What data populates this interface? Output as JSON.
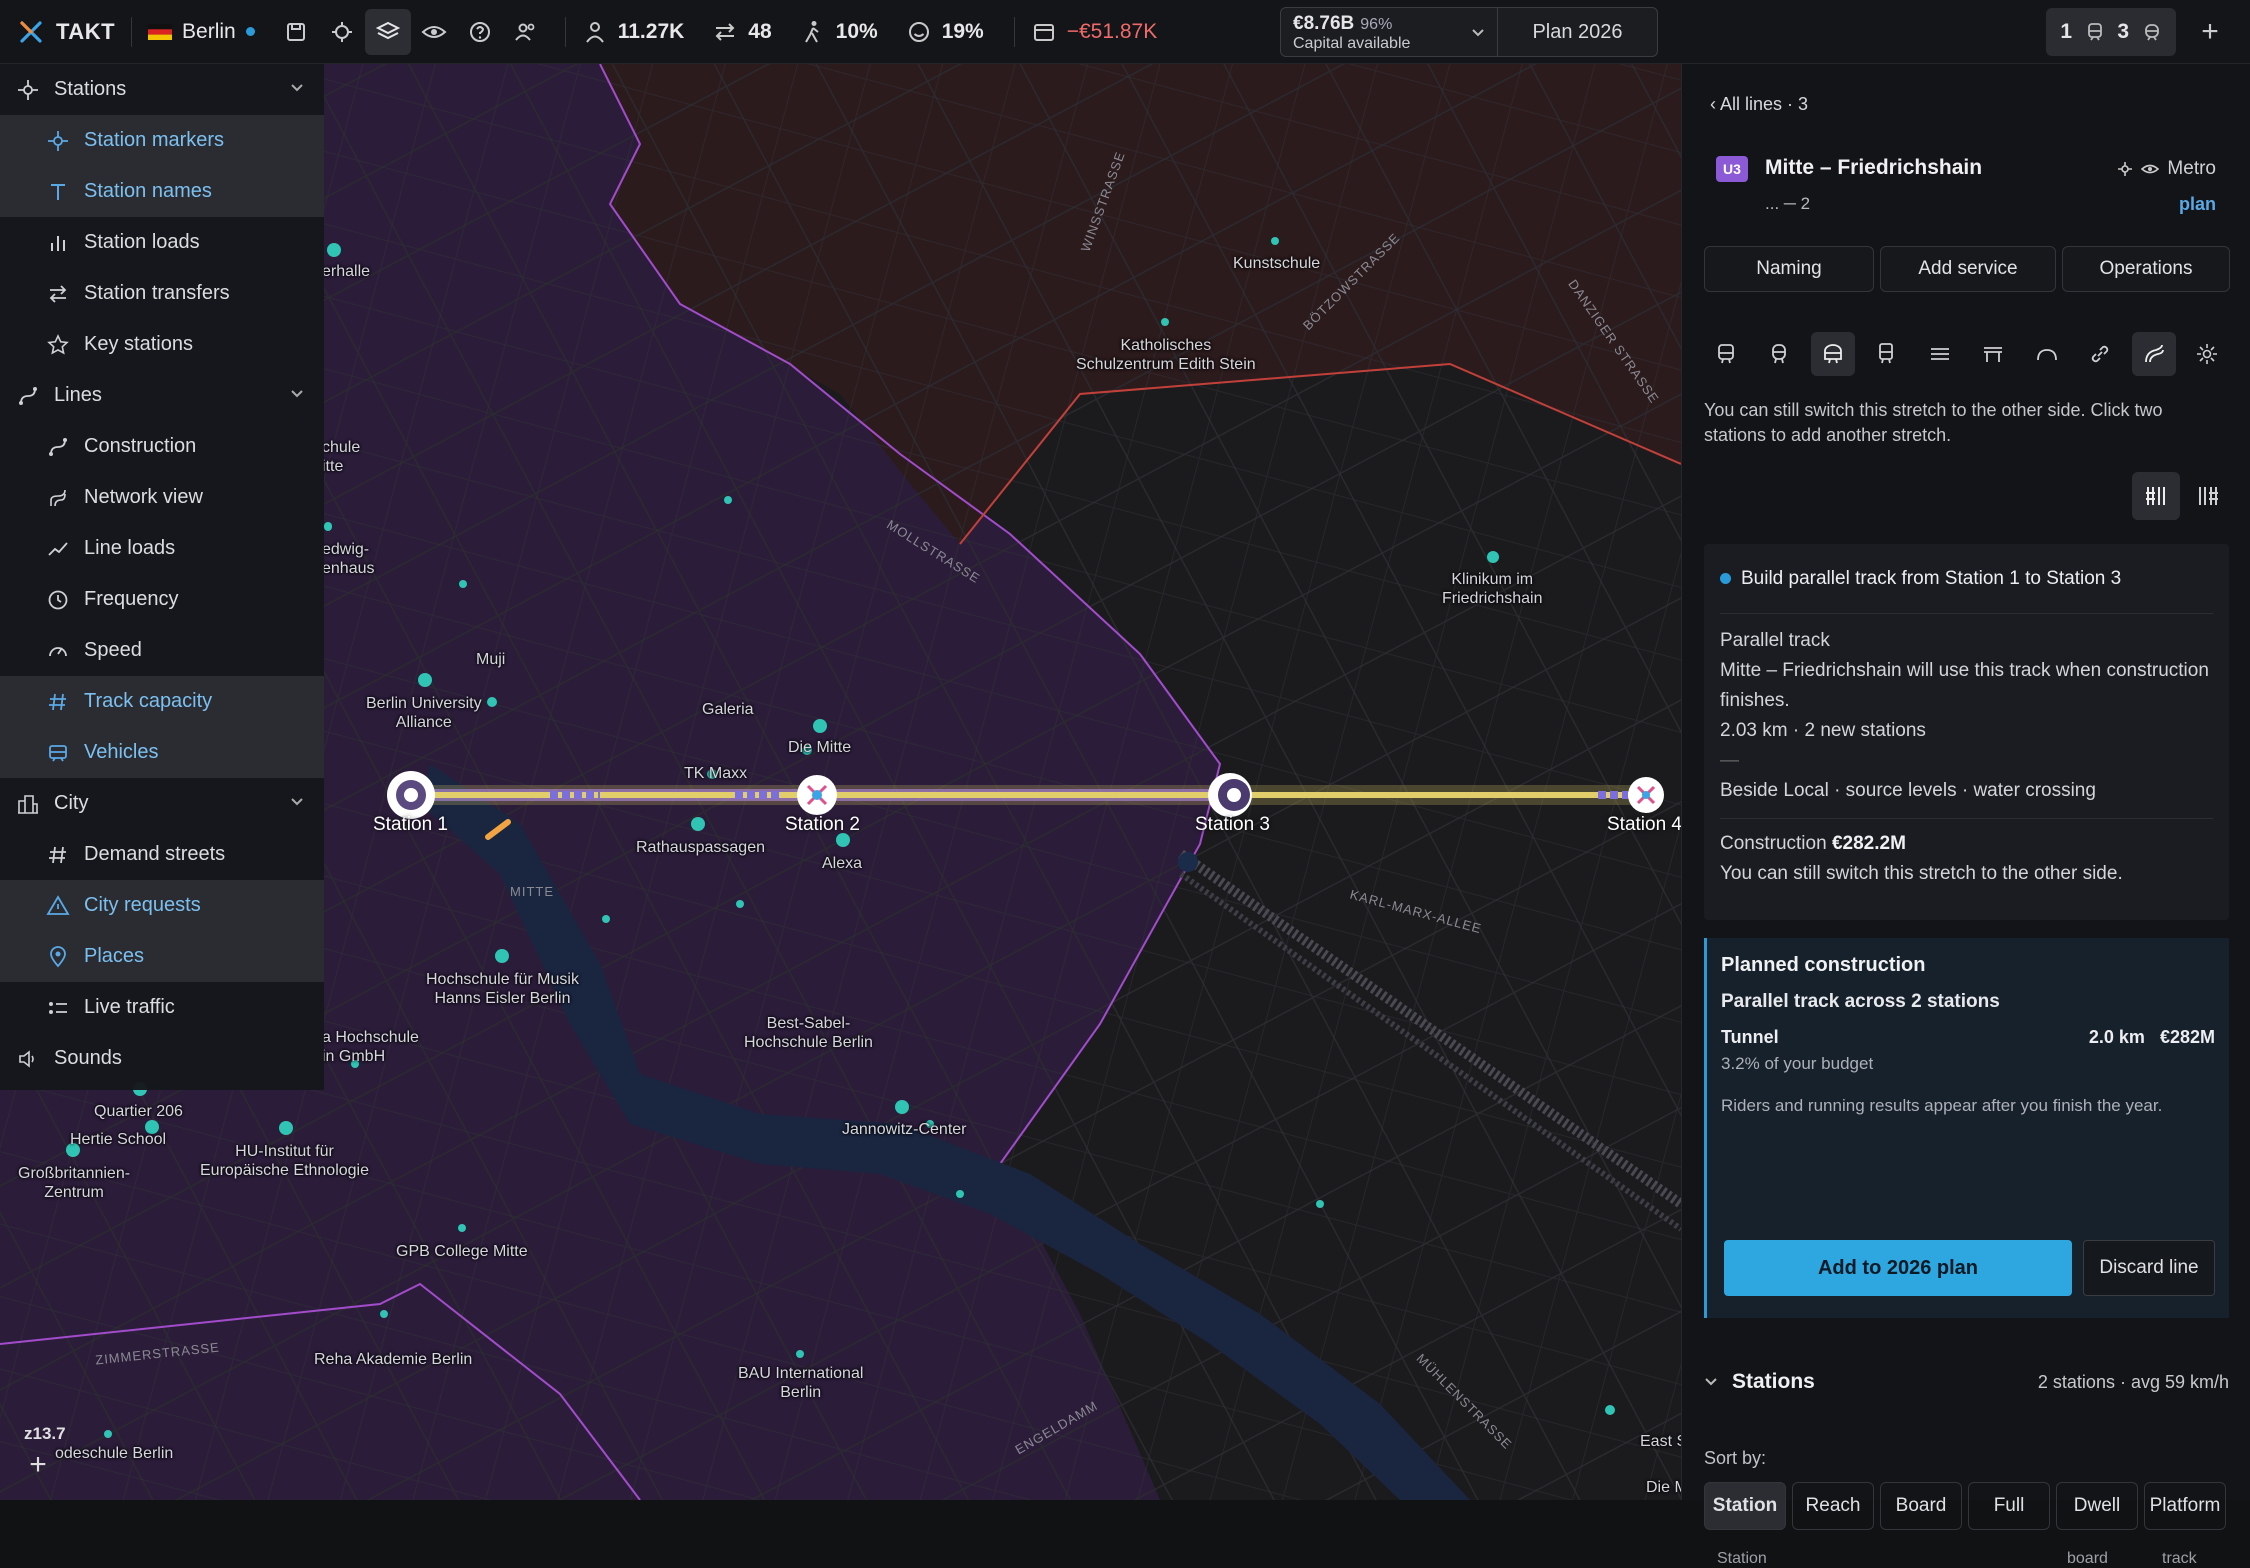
{
  "topbar": {
    "app_name": "TAKT",
    "city": "Berlin",
    "stats": {
      "riders": "11.27K",
      "transfers": "48",
      "walk_share": "10%",
      "satisfaction": "19%",
      "balance": "−€51.87K"
    },
    "capital": {
      "value": "€8.76B",
      "percent": "96%",
      "label": "Capital available"
    },
    "plan": "Plan 2026",
    "counts": {
      "first": "1",
      "second": "3"
    }
  },
  "sidebar": {
    "groups": [
      {
        "label": "Stations",
        "items": [
          "Station markers",
          "Station names",
          "Station loads",
          "Station transfers",
          "Key stations"
        ]
      },
      {
        "label": "Lines",
        "items": [
          "Construction",
          "Network view",
          "Line loads",
          "Frequency",
          "Speed",
          "Track capacity",
          "Vehicles"
        ]
      },
      {
        "label": "City",
        "items": [
          "Demand streets",
          "City requests",
          "Places",
          "Live traffic"
        ]
      },
      {
        "label": "Sounds",
        "items": []
      }
    ]
  },
  "map": {
    "zoom": "z13.7",
    "stations": [
      "Station 1",
      "Station 2",
      "Station 3",
      "Station 4"
    ],
    "places": {
      "p1": "erhalle",
      "p2": "chule\nitte",
      "p3": "edwig-\nenhaus",
      "p4": "Muji",
      "p5": "Berlin University\nAlliance",
      "p6": "Galeria",
      "p7": "Die Mitte",
      "p8": "TK Maxx",
      "p9": "Rathauspassagen",
      "p10": "Alexa",
      "p11": "Kunstschule",
      "p12": "Katholisches\nSchulzentrum Edith Stein",
      "p13": "Klinikum im\nFriedrichshain",
      "p14": "Hochschule für Musik\nHanns Eisler Berlin",
      "p15": "a Hochschule\nin GmbH",
      "p16": "Best-Sabel-\nHochschule Berlin",
      "p17": "Quartier 206",
      "p18": "Hertie School",
      "p19": "HU-Institut für\nEuropäische Ethnologie",
      "p20": "Großbritannien-\nZentrum",
      "p21": "Jannowitz-Center",
      "p22": "GPB College Mitte",
      "p23": "Reha Akademie Berlin",
      "p24": "BAU International\nBerlin",
      "p25": "odeschule Berlin",
      "p26": "East S",
      "p27": "Die M"
    },
    "streets": {
      "s1": "WINSSTRASSE",
      "s2": "BÖTZOWSTRASSE",
      "s3": "DANZIGER STRASSE",
      "s4": "MOLLSTRASSE",
      "s5": "KARL-MARX-ALLEE",
      "s6": "MITTE",
      "s7": "ZIMMERSTRASSE",
      "s8": "ENGELDAMM",
      "s9": "MÜHLENSTRASSE"
    }
  },
  "panel": {
    "back": "‹ All lines · 3",
    "badge": "U3",
    "title": "Mitte – Friedrichshain",
    "mode": "Metro",
    "subtitle": "... ─ 2",
    "plan_link": "plan",
    "tabs": [
      "Naming",
      "Add service",
      "Operations"
    ],
    "hint": "You can still switch this stretch to the other side. Click two stations to add another stretch.",
    "card": {
      "heading": "Build parallel track from Station 1 to Station 3",
      "track_label": "Parallel track",
      "track_text": "Mitte – Friedrichshain will use this track when construction finishes.",
      "length": "2.03 km · 2 new stations",
      "dash": "—",
      "context": "Beside Local · source levels · water crossing",
      "construction_label": "Construction",
      "construction_value": "€282.2M",
      "switch_note": "You can still switch this stretch to the other side."
    },
    "planned": {
      "heading": "Planned construction",
      "sub": "Parallel track across 2 stations",
      "type": "Tunnel",
      "length": "2.0 km",
      "cost": "€282M",
      "budget": "3.2% of your budget",
      "note": "Riders and running results appear after you finish the year.",
      "add_button": "Add to 2026 plan",
      "discard_button": "Discard line"
    },
    "stations": {
      "heading": "Stations",
      "meta": "2 stations · avg 59 km/h",
      "sort_label": "Sort by:",
      "sort_options": [
        "Station",
        "Reach",
        "Board",
        "Full",
        "Dwell",
        "Platform"
      ],
      "columns": [
        "Station",
        "board",
        "track"
      ]
    }
  },
  "colors": {
    "accent": "#2ea6e0",
    "line": "#d9c562",
    "badge": "#8c5ad6",
    "negative": "#ef6a6a"
  }
}
